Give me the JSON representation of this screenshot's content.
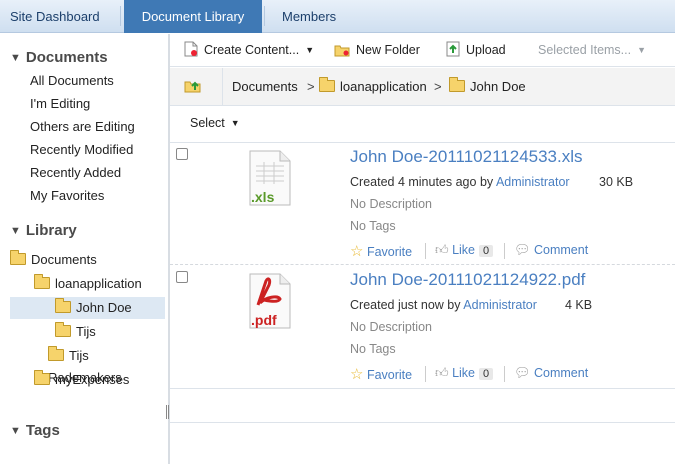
{
  "nav": {
    "tabs": [
      {
        "label": "Site Dashboard"
      },
      {
        "label": "Document Library"
      },
      {
        "label": "Members"
      }
    ]
  },
  "sidebar": {
    "documents": {
      "title": "Documents",
      "items": [
        "All Documents",
        "I'm Editing",
        "Others are Editing",
        "Recently Modified",
        "Recently Added",
        "My Favorites"
      ]
    },
    "library": {
      "title": "Library",
      "tree": [
        "Documents",
        "loanapplication",
        "John Doe",
        "Tijs",
        "Tijs Rademakers",
        "myExpenses"
      ]
    },
    "tags": {
      "title": "Tags"
    }
  },
  "toolbar": {
    "create": "Create Content...",
    "new_folder": "New Folder",
    "upload": "Upload",
    "selected": "Selected Items..."
  },
  "breadcrumb": {
    "items": [
      "Documents",
      "loanapplication",
      "John Doe"
    ],
    "separator": ">"
  },
  "select_label": "Select",
  "files": [
    {
      "name": "John Doe-20111021124533.xls",
      "type_label": ".xls",
      "created": "Created 4 minutes ago by",
      "author": "Administrator",
      "size": "30 KB",
      "description": "No Description",
      "tags": "No Tags",
      "favorite": "Favorite",
      "like": "Like",
      "like_count": "0",
      "comment": "Comment"
    },
    {
      "name": "John Doe-20111021124922.pdf",
      "type_label": ".pdf",
      "created": "Created just now by",
      "author": "Administrator",
      "size": "4 KB",
      "description": "No Description",
      "tags": "No Tags",
      "favorite": "Favorite",
      "like": "Like",
      "like_count": "0",
      "comment": "Comment"
    }
  ],
  "colors": {
    "accent": "#3f79b5",
    "link": "#4a7fc1",
    "xls": "#5a9a2a",
    "pdf": "#cc2222"
  }
}
